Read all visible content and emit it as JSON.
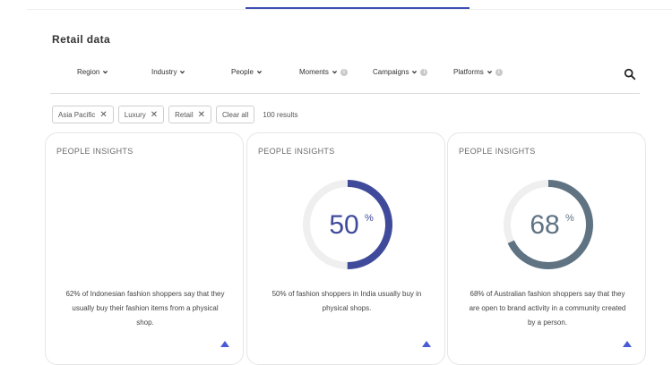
{
  "page": {
    "title": "Retail data"
  },
  "filters": [
    {
      "label": "Region",
      "has_info": false
    },
    {
      "label": "Industry",
      "has_info": false
    },
    {
      "label": "People",
      "has_info": false
    },
    {
      "label": "Moments",
      "has_info": true
    },
    {
      "label": "Campaigns",
      "has_info": true
    },
    {
      "label": "Platforms",
      "has_info": true
    }
  ],
  "active_filters": [
    {
      "label": "Asia Pacific"
    },
    {
      "label": "Luxury"
    },
    {
      "label": "Retail"
    }
  ],
  "clear_all_label": "Clear all",
  "results_text": "100 results",
  "cards": [
    {
      "label": "PEOPLE INSIGHTS",
      "stat": null,
      "text": "62% of Indonesian fashion shoppers say that they usually buy their fashion items from a physical shop."
    },
    {
      "label": "PEOPLE INSIGHTS",
      "stat": {
        "value": "50",
        "unit": "%",
        "fraction": 0.5,
        "color": "#3f4a9b"
      },
      "text": "50% of fashion shoppers in India usually buy in physical shops."
    },
    {
      "label": "PEOPLE INSIGHTS",
      "stat": {
        "value": "68",
        "unit": "%",
        "fraction": 0.68,
        "color": "#5f7382"
      },
      "text": "68% of Australian fashion shoppers say that they are open to brand activity in a community created by a person."
    }
  ],
  "colors": {
    "accent": "#3f51b5",
    "ring_track": "#efefef"
  }
}
